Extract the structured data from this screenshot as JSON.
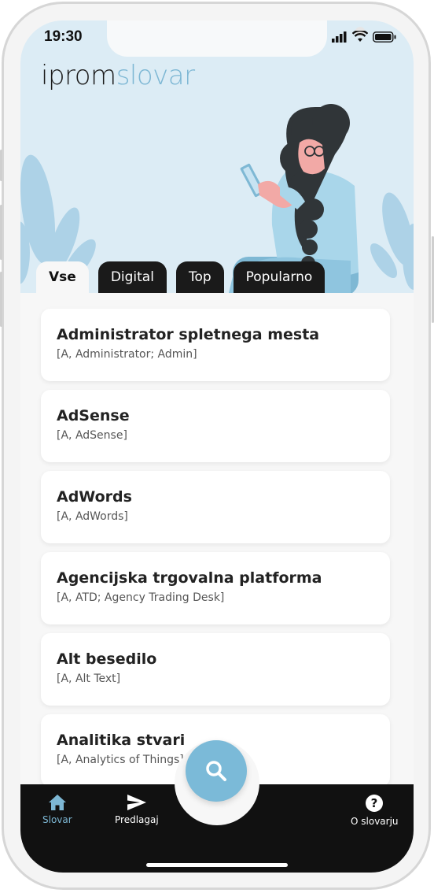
{
  "status": {
    "time": "19:30"
  },
  "logo": {
    "part1": "iprom",
    "part2": "slovar"
  },
  "tabs": [
    {
      "label": "Vse",
      "active": true
    },
    {
      "label": "Digital",
      "active": false
    },
    {
      "label": "Top",
      "active": false
    },
    {
      "label": "Popularno",
      "active": false
    }
  ],
  "entries": [
    {
      "title": "Administrator spletnega mesta",
      "sub": "[A, Administrator; Admin]"
    },
    {
      "title": "AdSense",
      "sub": "[A, AdSense]"
    },
    {
      "title": "AdWords",
      "sub": "[A, AdWords]"
    },
    {
      "title": "Agencijska trgovalna platforma",
      "sub": "[A, ATD; Agency Trading Desk]"
    },
    {
      "title": "Alt besedilo",
      "sub": "[A, Alt Text]"
    },
    {
      "title": "Analitika stvari",
      "sub": "[A, Analytics of Things]"
    }
  ],
  "nav": {
    "slovar": "Slovar",
    "predlagaj": "Predlagaj",
    "o_slovarju": "O slovarju"
  },
  "colors": {
    "accent": "#7db7d4",
    "dark": "#111111",
    "hero_bg": "#dcecf5"
  },
  "icons": [
    "home-icon",
    "send-icon",
    "help-icon",
    "search-icon"
  ]
}
